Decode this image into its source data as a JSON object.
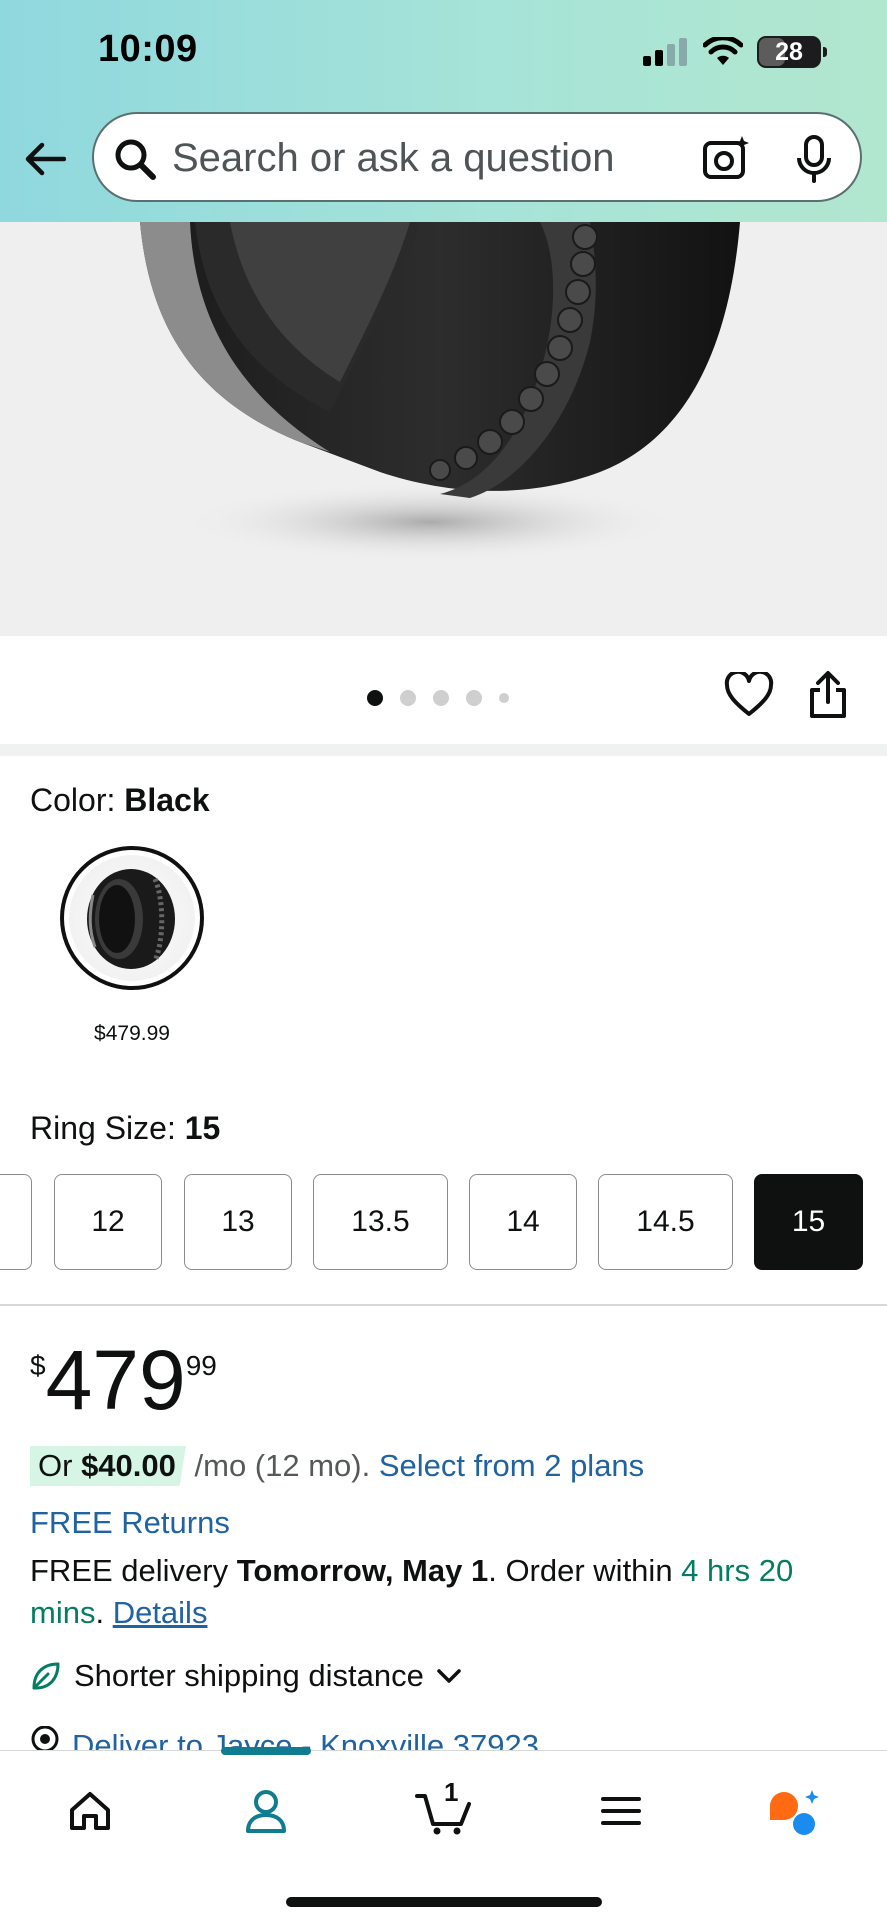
{
  "status_bar": {
    "time": "10:09",
    "battery": "28"
  },
  "header": {
    "search_placeholder": "Search or ask a question"
  },
  "gallery": {
    "dots": 5,
    "active_index": 0
  },
  "color": {
    "label": "Color: ",
    "value": "Black",
    "swatch_price": "$479.99"
  },
  "ring_size": {
    "label": "Ring Size: ",
    "value": "15",
    "options": [
      "12",
      "13",
      "13.5",
      "14",
      "14.5",
      "15"
    ],
    "selected": "15"
  },
  "price": {
    "symbol": "$",
    "whole": "479",
    "fraction": "99"
  },
  "monthly": {
    "or": "Or ",
    "amount": "$40.00",
    "term": " /mo (12 mo). ",
    "plans_link": "Select from 2 plans"
  },
  "returns": {
    "label": "FREE Returns"
  },
  "delivery": {
    "prefix": "FREE delivery ",
    "date": "Tomorrow, May 1",
    "middle": ". Order within ",
    "countdown": "4 hrs 20 mins",
    "sep": ". ",
    "details_link": "Details"
  },
  "shipping": {
    "label": "Shorter shipping distance"
  },
  "deliver_to": {
    "label": "Deliver to Jayce - Knoxville 37923"
  },
  "bottom_nav": {
    "cart_count": "1"
  },
  "colors": {
    "accent_link": "#2162a1",
    "green": "#067d62",
    "nav_active": "#0f7c90"
  }
}
